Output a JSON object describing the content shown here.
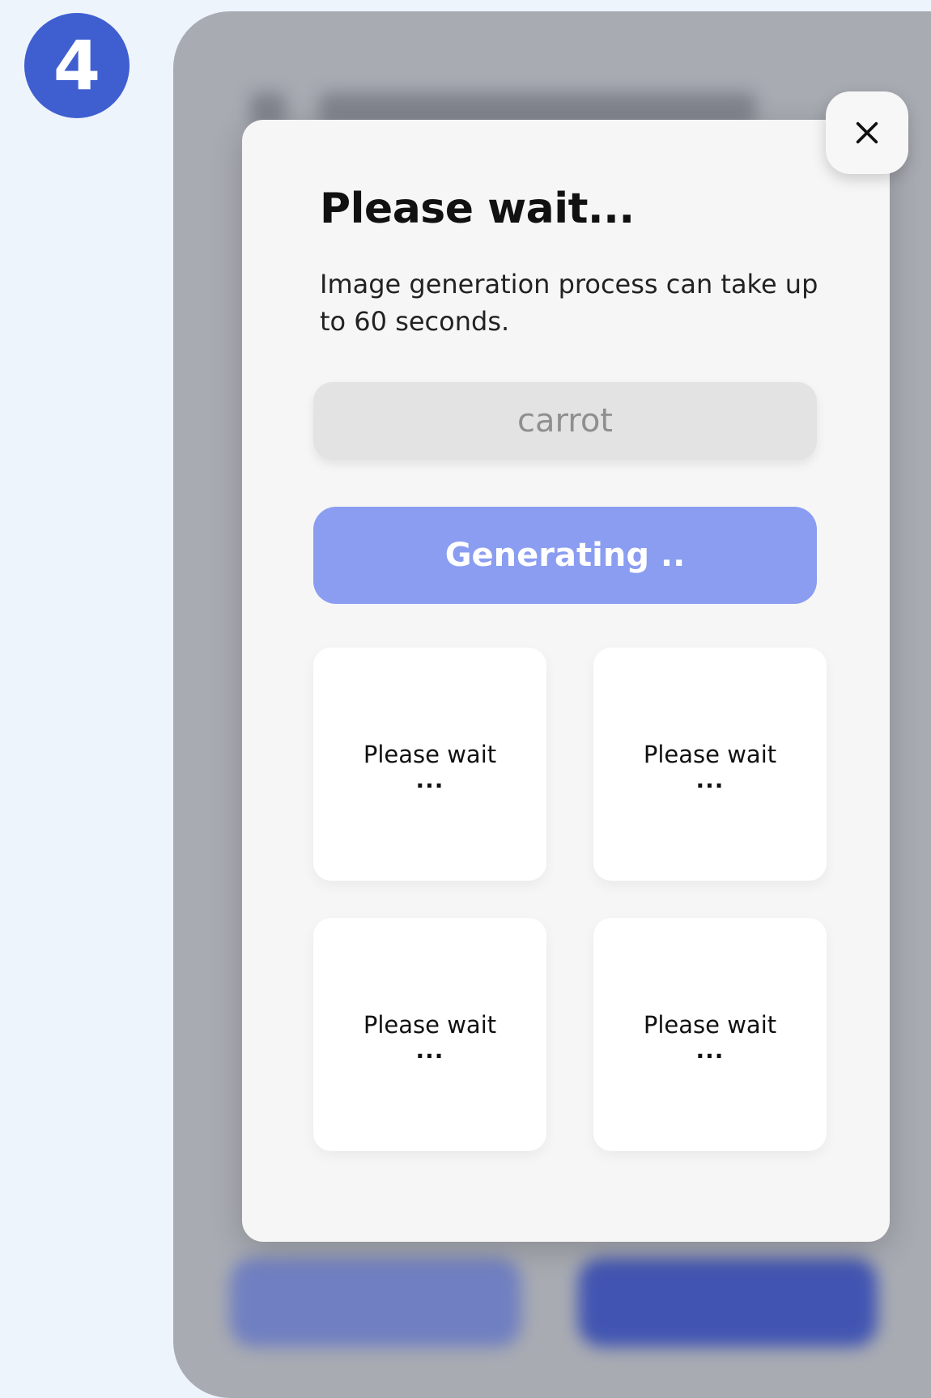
{
  "step": {
    "number": "4"
  },
  "modal": {
    "title": "Please wait...",
    "subtitle": "Image generation process can take up to 60 seconds.",
    "prompt_value": "carrot",
    "generate_label": "Generating ..",
    "close_icon": "close-icon"
  },
  "tiles": [
    {
      "label": "Please wait",
      "dots": "..."
    },
    {
      "label": "Please wait",
      "dots": "..."
    },
    {
      "label": "Please wait",
      "dots": "..."
    },
    {
      "label": "Please wait",
      "dots": "..."
    }
  ],
  "colors": {
    "badge": "#3f5fd1",
    "page_background": "#eef4fc",
    "overlay": "#a8abb2",
    "modal_background": "#f6f6f6",
    "input_background": "#e3e3e3",
    "generate_button": "#8a9df1",
    "bg_button_left": "#6778c4",
    "bg_button_right": "#3046b2"
  }
}
